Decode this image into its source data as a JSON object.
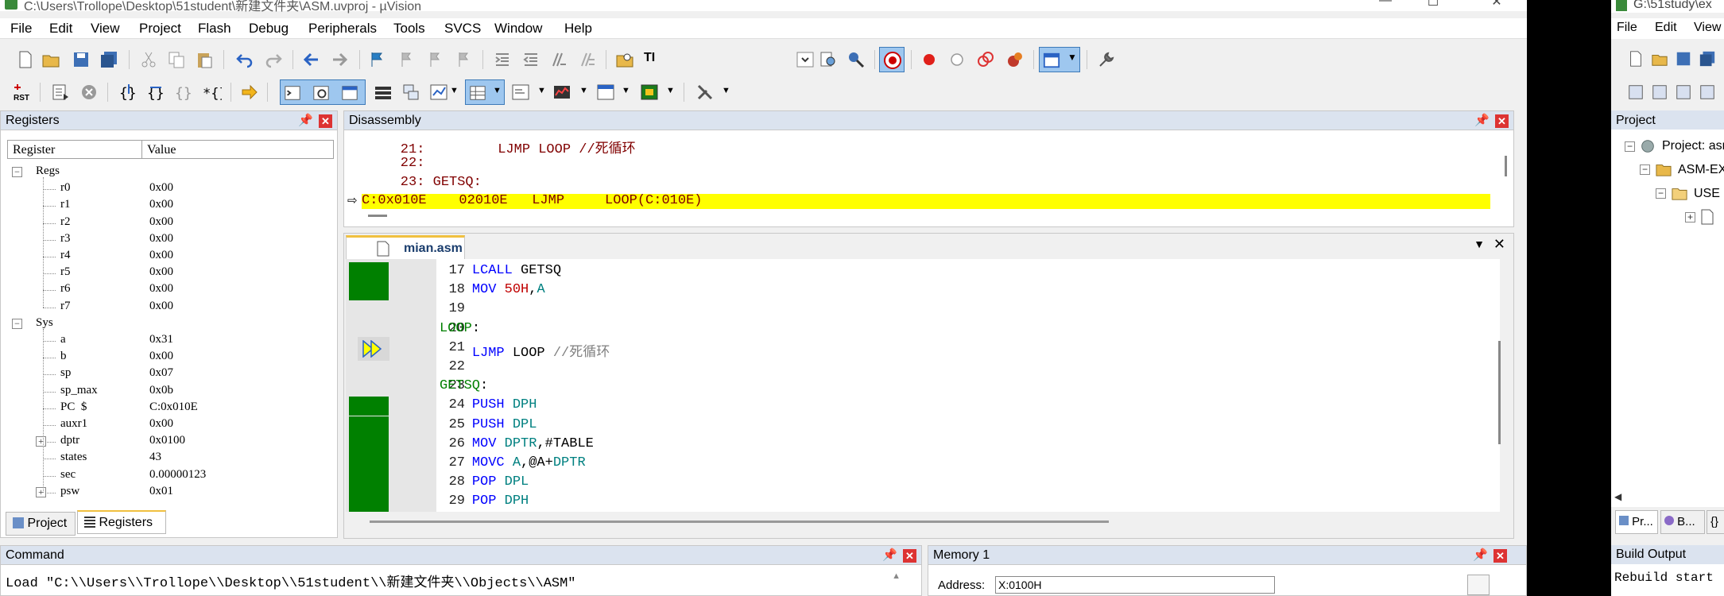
{
  "window": {
    "title": "C:\\Users\\Trollope\\Desktop\\51student\\新建文件夹\\ASM.uvproj - µVision",
    "minimize": "—",
    "maximize": "☐",
    "close": "✕"
  },
  "menu": [
    "File",
    "Edit",
    "View",
    "Project",
    "Flash",
    "Debug",
    "Peripherals",
    "Tools",
    "SVCS",
    "Window",
    "Help"
  ],
  "toolbar": {
    "ti_label": "TI"
  },
  "registers": {
    "title": "Registers",
    "col_register": "Register",
    "col_value": "Value",
    "groups": [
      {
        "name": "Regs",
        "rows": [
          {
            "name": "r0",
            "value": "0x00"
          },
          {
            "name": "r1",
            "value": "0x00"
          },
          {
            "name": "r2",
            "value": "0x00"
          },
          {
            "name": "r3",
            "value": "0x00"
          },
          {
            "name": "r4",
            "value": "0x00"
          },
          {
            "name": "r5",
            "value": "0x00"
          },
          {
            "name": "r6",
            "value": "0x00"
          },
          {
            "name": "r7",
            "value": "0x00"
          }
        ]
      },
      {
        "name": "Sys",
        "rows": [
          {
            "name": "a",
            "value": "0x31"
          },
          {
            "name": "b",
            "value": "0x00"
          },
          {
            "name": "sp",
            "value": "0x07"
          },
          {
            "name": "sp_max",
            "value": "0x0b"
          },
          {
            "name": "PC  $",
            "value": "C:0x010E"
          },
          {
            "name": "auxr1",
            "value": "0x00"
          },
          {
            "name": "dptr",
            "value": "0x0100"
          },
          {
            "name": "states",
            "value": "43"
          },
          {
            "name": "sec",
            "value": "0.00000123"
          },
          {
            "name": "psw",
            "value": "0x01"
          }
        ]
      }
    ],
    "tab_project": "Project",
    "tab_registers": "Registers"
  },
  "disassembly": {
    "title": "Disassembly",
    "lines": [
      "    21:         LJMP LOOP //死循环",
      "    22:",
      "    23: GETSQ:",
      "C:0x010E    02010E   LJMP     LOOP(C:010E)"
    ]
  },
  "editor": {
    "tab": "mian.asm",
    "lines": [
      {
        "n": "17",
        "code": [
          {
            "t": "    ",
            "c": "idt"
          },
          {
            "t": "LCALL",
            "c": "kw"
          },
          {
            "t": " GETSQ",
            "c": "idt"
          }
        ]
      },
      {
        "n": "18",
        "code": [
          {
            "t": "    ",
            "c": "idt"
          },
          {
            "t": "MOV",
            "c": "kw"
          },
          {
            "t": " ",
            "c": "idt"
          },
          {
            "t": "50H",
            "c": "num"
          },
          {
            "t": ",",
            "c": "idt"
          },
          {
            "t": "A",
            "c": "reg"
          }
        ]
      },
      {
        "n": "19",
        "code": []
      },
      {
        "n": "20",
        "code": [
          {
            "t": "LOOP",
            "c": "lbl"
          },
          {
            "t": ":",
            "c": "idt"
          }
        ]
      },
      {
        "n": "21",
        "code": [
          {
            "t": "    ",
            "c": "idt"
          },
          {
            "t": "LJMP",
            "c": "kw"
          },
          {
            "t": " LOOP ",
            "c": "idt"
          },
          {
            "t": "//死循环",
            "c": "cmt"
          }
        ]
      },
      {
        "n": "22",
        "code": []
      },
      {
        "n": "23",
        "code": [
          {
            "t": "GETSQ",
            "c": "lbl"
          },
          {
            "t": ":",
            "c": "idt"
          }
        ]
      },
      {
        "n": "24",
        "code": [
          {
            "t": "    ",
            "c": "idt"
          },
          {
            "t": "PUSH",
            "c": "kw"
          },
          {
            "t": " ",
            "c": "idt"
          },
          {
            "t": "DPH",
            "c": "reg"
          }
        ]
      },
      {
        "n": "25",
        "code": [
          {
            "t": "    ",
            "c": "idt"
          },
          {
            "t": "PUSH",
            "c": "kw"
          },
          {
            "t": " ",
            "c": "idt"
          },
          {
            "t": "DPL",
            "c": "reg"
          }
        ]
      },
      {
        "n": "26",
        "code": [
          {
            "t": "    ",
            "c": "idt"
          },
          {
            "t": "MOV",
            "c": "kw"
          },
          {
            "t": " ",
            "c": "idt"
          },
          {
            "t": "DPTR",
            "c": "reg"
          },
          {
            "t": ",#TABLE",
            "c": "idt"
          }
        ]
      },
      {
        "n": "27",
        "code": [
          {
            "t": "    ",
            "c": "idt"
          },
          {
            "t": "MOVC",
            "c": "kw"
          },
          {
            "t": " ",
            "c": "idt"
          },
          {
            "t": "A",
            "c": "reg"
          },
          {
            "t": ",@A+",
            "c": "idt"
          },
          {
            "t": "DPTR",
            "c": "reg"
          }
        ]
      },
      {
        "n": "28",
        "code": [
          {
            "t": "    ",
            "c": "idt"
          },
          {
            "t": "POP",
            "c": "kw"
          },
          {
            "t": " ",
            "c": "idt"
          },
          {
            "t": "DPL",
            "c": "reg"
          }
        ]
      },
      {
        "n": "29",
        "code": [
          {
            "t": "    ",
            "c": "idt"
          },
          {
            "t": "POP",
            "c": "kw"
          },
          {
            "t": " ",
            "c": "idt"
          },
          {
            "t": "DPH",
            "c": "reg"
          }
        ]
      }
    ]
  },
  "command": {
    "title": "Command",
    "line": "Load \"C:\\\\Users\\\\Trollope\\\\Desktop\\\\51student\\\\新建文件夹\\\\Objects\\\\ASM\""
  },
  "memory": {
    "title": "Memory 1",
    "address_label": "Address:",
    "address_value": "X:0100H"
  },
  "second_window": {
    "title": "G:\\51study\\ex",
    "menu": [
      "File",
      "Edit",
      "View"
    ],
    "project_title": "Project",
    "tree": [
      "Project: asm",
      "ASM-EX",
      "USE"
    ],
    "tabs": [
      "Pr...",
      "B...",
      "{}"
    ],
    "build_title": "Build Output",
    "build_line": "Rebuild start"
  }
}
